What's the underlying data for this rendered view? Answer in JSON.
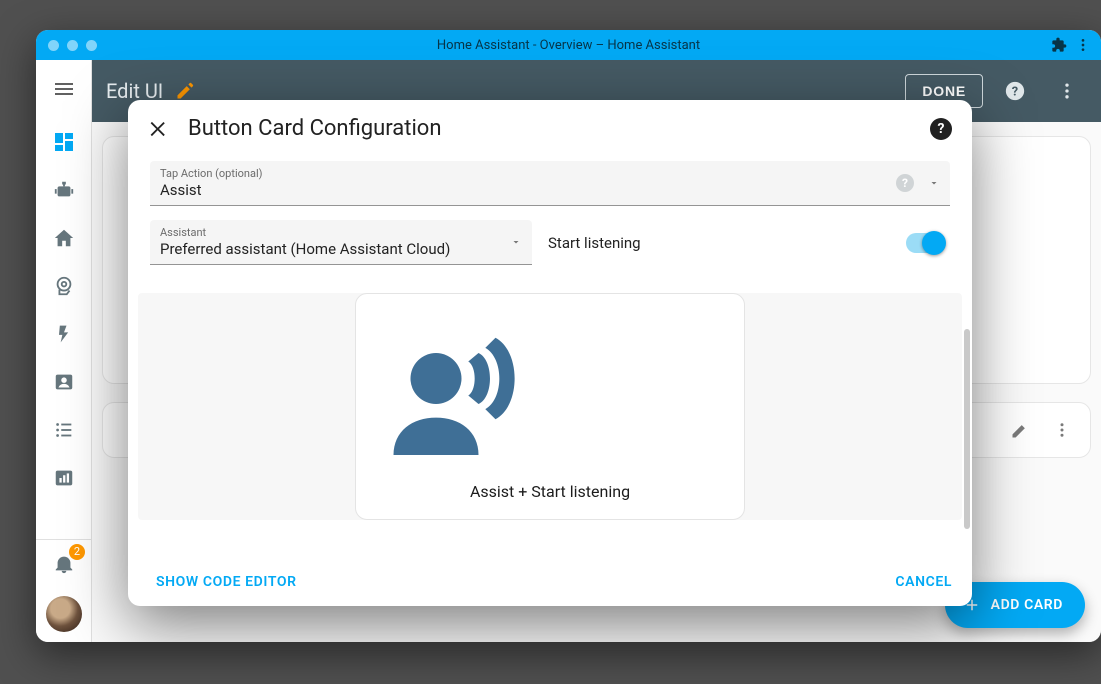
{
  "window": {
    "title": "Home Assistant - Overview – Home Assistant"
  },
  "sidebar": {
    "notification_count": "2"
  },
  "edit_bar": {
    "title": "Edit UI",
    "done_label": "DONE"
  },
  "fab": {
    "label": "ADD CARD"
  },
  "modal": {
    "title": "Button Card Configuration",
    "tap_action": {
      "label": "Tap Action (optional)",
      "value": "Assist"
    },
    "assistant": {
      "label": "Assistant",
      "value": "Preferred assistant (Home Assistant Cloud)"
    },
    "start_listening": {
      "label": "Start listening",
      "enabled": true
    },
    "preview_caption": "Assist + Start listening",
    "show_code_label": "SHOW CODE EDITOR",
    "cancel_label": "CANCEL"
  }
}
